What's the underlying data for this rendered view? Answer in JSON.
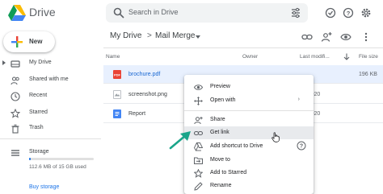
{
  "app": {
    "name": "Drive"
  },
  "search": {
    "placeholder": "Search in Drive"
  },
  "sidebar": {
    "new_label": "New",
    "items": [
      {
        "label": "My Drive",
        "icon": "my-drive-icon"
      },
      {
        "label": "Shared with me",
        "icon": "people-icon"
      },
      {
        "label": "Recent",
        "icon": "clock-icon"
      },
      {
        "label": "Starred",
        "icon": "star-icon"
      },
      {
        "label": "Trash",
        "icon": "trash-icon"
      }
    ],
    "storage_label": "Storage",
    "storage_used": "112.6 MB of 15 GB used",
    "storage_fraction": 0.01,
    "buy_storage": "Buy storage"
  },
  "breadcrumb": {
    "root": "My Drive",
    "separator": ">",
    "current": "Mail Merge"
  },
  "table": {
    "headers": {
      "name": "Name",
      "owner": "Owner",
      "modified": "Last modifi...",
      "size": "File size"
    },
    "rows": [
      {
        "name": "brochure.pdf",
        "modified": "",
        "size": "196 KB",
        "type": "pdf",
        "selected": true
      },
      {
        "name": "screenshot.png",
        "modified": "..., 2020",
        "size": "",
        "type": "image",
        "selected": false
      },
      {
        "name": "Report",
        "modified": "..., 2020",
        "size": "",
        "type": "doc",
        "selected": false
      }
    ]
  },
  "context_menu": {
    "items": [
      {
        "label": "Preview",
        "icon": "eye-icon"
      },
      {
        "label": "Open with",
        "icon": "move-arrows-icon",
        "submenu": true
      },
      {
        "label": "Share",
        "icon": "add-person-icon"
      },
      {
        "label": "Get link",
        "icon": "link-icon",
        "highlighted": true
      },
      {
        "label": "Add shortcut to Drive",
        "icon": "drive-shortcut-icon"
      },
      {
        "label": "Move to",
        "icon": "move-folder-icon"
      },
      {
        "label": "Add to Starred",
        "icon": "star-icon"
      },
      {
        "label": "Rename",
        "icon": "pencil-icon"
      }
    ],
    "submenu_arrow": "›"
  },
  "colors": {
    "accent": "#1a73e8",
    "pointer_arrow": "#1aa58a",
    "selected_row": "#e8f0fe"
  }
}
